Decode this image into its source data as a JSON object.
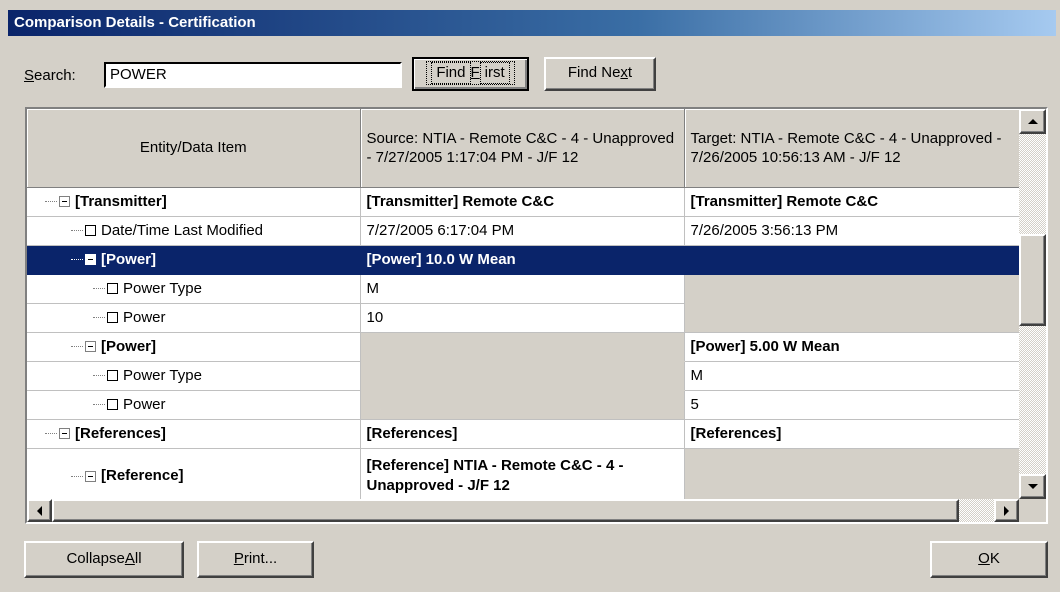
{
  "window": {
    "title": "Comparison Details - Certification"
  },
  "search": {
    "label_pre": "",
    "label_mnemonic": "S",
    "label_post": "earch:",
    "value": "POWER",
    "find_first_pre": "Find ",
    "find_first_mnemonic": "F",
    "find_first_post": "irst",
    "find_next_pre": "Find Ne",
    "find_next_mnemonic": "x",
    "find_next_post": "t"
  },
  "grid": {
    "columns": [
      "Entity/Data Item",
      "Source: NTIA - Remote C&C - 4 - Unapproved - 7/27/2005 1:17:04 PM - J/F 12",
      "Target: NTIA - Remote C&C - 4 - Unapproved - 7/26/2005 10:56:13 AM - J/F 12"
    ],
    "rows": [
      {
        "label": "[Transmitter]",
        "source": "[Transmitter] Remote C&C",
        "target": "[Transmitter] Remote C&C"
      },
      {
        "label": "Date/Time Last Modified",
        "source": "7/27/2005 6:17:04 PM",
        "target": "7/26/2005 3:56:13 PM"
      },
      {
        "label": "[Power]",
        "source": "[Power] 10.0 W Mean",
        "target": ""
      },
      {
        "label": "Power Type",
        "source": "M",
        "target": ""
      },
      {
        "label": "Power",
        "source": "10",
        "target": ""
      },
      {
        "label": "[Power]",
        "source": "",
        "target": "[Power] 5.00 W Mean"
      },
      {
        "label": "Power Type",
        "source": "",
        "target": "M"
      },
      {
        "label": "Power",
        "source": "",
        "target": "5"
      },
      {
        "label": "[References]",
        "source": "[References]",
        "target": "[References]"
      },
      {
        "label": "[Reference]",
        "source": "[Reference] NTIA - Remote C&C - 4 - Unapproved - J/F 12",
        "target": ""
      }
    ]
  },
  "footer": {
    "collapse_pre": "Collapse ",
    "collapse_mnemonic": "A",
    "collapse_post": "ll",
    "print_pre": "",
    "print_mnemonic": "P",
    "print_post": "rint...",
    "ok_pre": "",
    "ok_mnemonic": "O",
    "ok_post": "K"
  },
  "colors": {
    "selection": "#0a246a",
    "face": "#d4d0c8",
    "title_gradient_start": "#0a246a",
    "title_gradient_end": "#a6caf0"
  }
}
